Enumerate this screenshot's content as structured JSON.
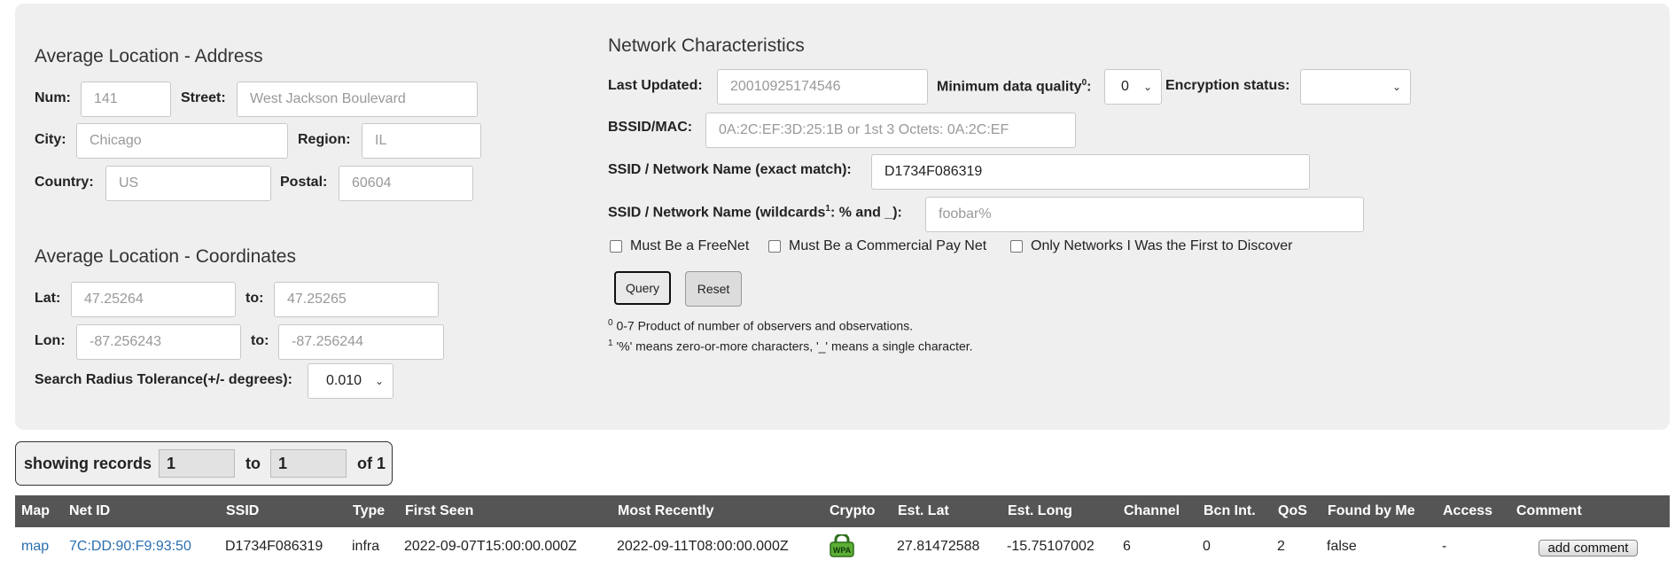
{
  "address": {
    "heading": "Average Location - Address",
    "num_label": "Num:",
    "num_placeholder": "141",
    "street_label": "Street:",
    "street_placeholder": "West Jackson Boulevard",
    "city_label": "City:",
    "city_placeholder": "Chicago",
    "region_label": "Region:",
    "region_placeholder": "IL",
    "country_label": "Country:",
    "country_placeholder": "US",
    "postal_label": "Postal:",
    "postal_placeholder": "60604"
  },
  "coordinates": {
    "heading": "Average Location - Coordinates",
    "lat_label": "Lat:",
    "lat_from_placeholder": "47.25264",
    "to_label": "to:",
    "lat_to_placeholder": "47.25265",
    "lon_label": "Lon:",
    "lon_from_placeholder": "-87.256243",
    "lon_to_placeholder": "-87.256244",
    "radius_label": "Search Radius Tolerance(+/- degrees):",
    "radius_value": "0.010"
  },
  "network": {
    "heading": "Network Characteristics",
    "last_updated_label": "Last Updated:",
    "last_updated_placeholder": "20010925174546",
    "min_quality_label": "Minimum data quality",
    "min_quality_sup": "0",
    "min_quality_value": "0",
    "encryption_label": "Encryption status:",
    "encryption_value": "",
    "bssid_label": "BSSID/MAC:",
    "bssid_placeholder": "0A:2C:EF:3D:25:1B or 1st 3 Octets: 0A:2C:EF",
    "ssid_exact_label": "SSID / Network Name (exact match):",
    "ssid_exact_value": "D1734F086319",
    "ssid_wild_label_a": "SSID / Network Name (wildcards",
    "ssid_wild_sup": "1",
    "ssid_wild_label_b": ": % and _):",
    "ssid_wild_placeholder": "foobar%",
    "freenet_label": "Must Be a FreeNet",
    "paynet_label": "Must Be a Commercial Pay Net",
    "first_label": "Only Networks I Was the First to Discover",
    "query_label": "Query",
    "reset_label": "Reset",
    "note0_sup": "0",
    "note0": " 0-7 Product of number of observers and observations.",
    "note1_sup": "1",
    "note1": " '%' means zero-or-more characters, '_' means a single character."
  },
  "records": {
    "showing_label": "showing records",
    "from": "1",
    "to_label": "to",
    "to": "1",
    "of_label": "of 1"
  },
  "table": {
    "headers": [
      "Map",
      "Net ID",
      "SSID",
      "Type",
      "First Seen",
      "Most Recently",
      "Crypto",
      "Est. Lat",
      "Est. Long",
      "Channel",
      "Bcn Int.",
      "QoS",
      "Found by Me",
      "Access",
      "Comment"
    ],
    "row": {
      "map": "map",
      "netid": "7C:DD:90:F9:93:50",
      "ssid": "D1734F086319",
      "type": "infra",
      "first_seen": "2022-09-07T15:00:00.000Z",
      "most_recently": "2022-09-11T08:00:00.000Z",
      "crypto_icon": "wpa-lock-icon",
      "crypto_text": "WPA",
      "est_lat": "27.81472588",
      "est_long": "-15.75107002",
      "channel": "6",
      "bcn_int": "0",
      "qos": "2",
      "found_by_me": "false",
      "access": "-",
      "comment_button": "add comment"
    }
  },
  "colors": {
    "panel": "#efefef",
    "header_bg": "#555555",
    "link": "#2a6fb0",
    "wpa_green": "#4a9a2a"
  }
}
